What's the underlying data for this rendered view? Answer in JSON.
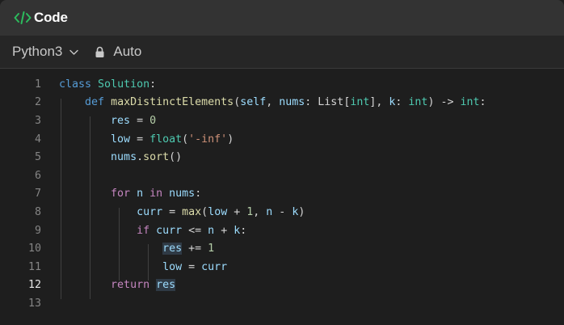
{
  "header": {
    "title": "Code"
  },
  "toolbar": {
    "language": "Python3",
    "mode": "Auto"
  },
  "colors": {
    "accent_icon": "#2cbb5d",
    "keyword": "#569cd6",
    "class": "#4ec9b0",
    "function": "#dcdcaa",
    "variable": "#9cdcfe",
    "number": "#b5cea8",
    "string": "#ce9178",
    "control": "#c586c0"
  },
  "editor": {
    "active_line": 12,
    "lines": [
      {
        "no": "1",
        "text": "class Solution:"
      },
      {
        "no": "2",
        "text": "    def maxDistinctElements(self, nums: List[int], k: int) -> int:"
      },
      {
        "no": "3",
        "text": "        res = 0"
      },
      {
        "no": "4",
        "text": "        low = float('-inf')"
      },
      {
        "no": "5",
        "text": "        nums.sort()"
      },
      {
        "no": "6",
        "text": ""
      },
      {
        "no": "7",
        "text": "        for n in nums:"
      },
      {
        "no": "8",
        "text": "            curr = max(low + 1, n - k)"
      },
      {
        "no": "9",
        "text": "            if curr <= n + k:"
      },
      {
        "no": "10",
        "text": "                res += 1"
      },
      {
        "no": "11",
        "text": "                low = curr"
      },
      {
        "no": "12",
        "text": "        return res"
      },
      {
        "no": "13",
        "text": ""
      }
    ]
  }
}
